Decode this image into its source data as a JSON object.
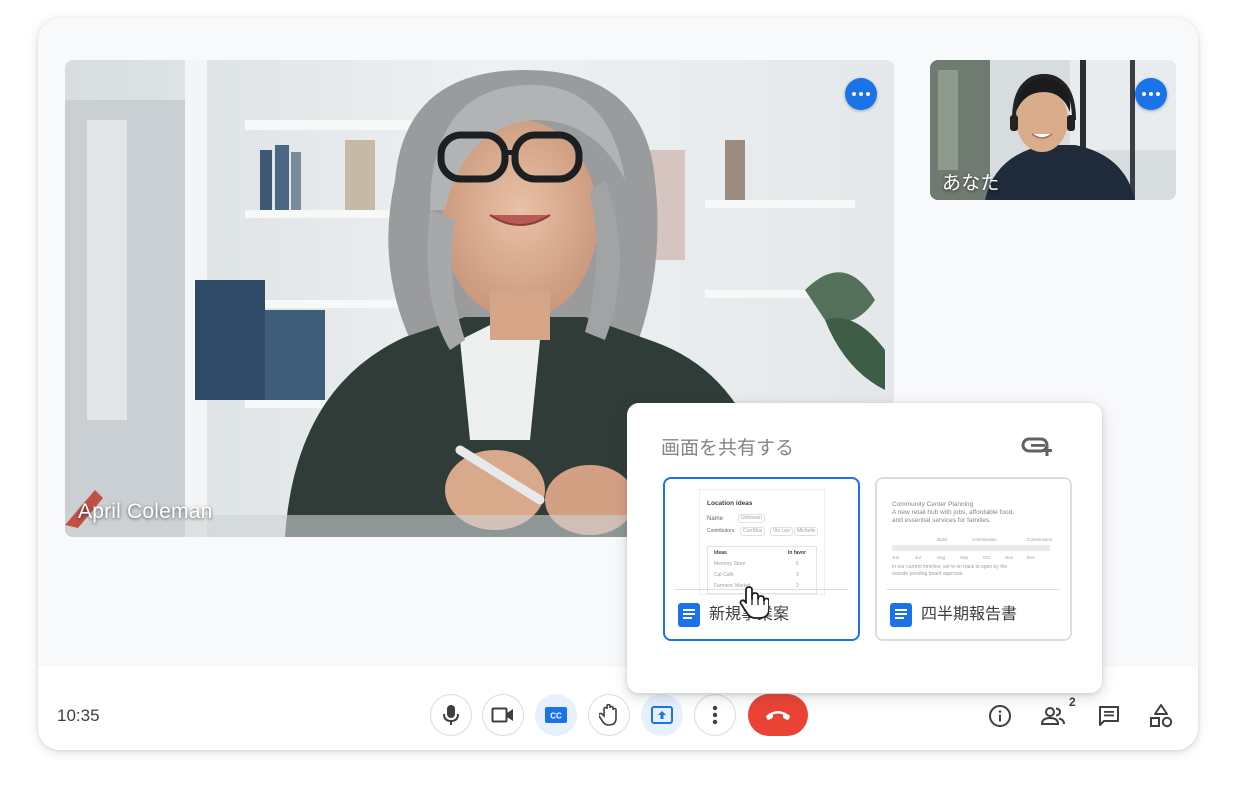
{
  "main_tile": {
    "participant_name": "April Coleman"
  },
  "self_tile": {
    "participant_name": "あなた"
  },
  "share_panel": {
    "title": "画面を共有する",
    "windows": [
      {
        "label": "新規事業案",
        "preview": {
          "heading": "Location ideas",
          "row_labels": [
            "Name",
            "Contributors"
          ],
          "name_value": "Unknown",
          "contributors": [
            "CurrMus",
            "Vin Lee",
            "Michelle"
          ],
          "table_headers": [
            "Ideas",
            "In favor"
          ],
          "table_rows": [
            [
              "Memory Store",
              "5"
            ],
            [
              "Cat Café",
              "3"
            ],
            [
              "Farmers' Market",
              "2"
            ]
          ]
        }
      },
      {
        "label": "四半期報告書",
        "preview": {
          "title": "Community Center Planning",
          "subtitle_lines": [
            "A new retail hub with jobs, affordable food,",
            "and essential services for families."
          ],
          "phases": [
            "Build",
            "Commission",
            "Construction"
          ],
          "months": [
            "Jun",
            "Jul",
            "Aug",
            "Sep",
            "Oct",
            "Nov",
            "Dec"
          ],
          "note_lines": [
            "In our current timeline, we're on track to open by the",
            "outside pending board approval."
          ]
        }
      }
    ]
  },
  "controls": {
    "time": "10:35",
    "participants_count": "2"
  },
  "colors": {
    "accent": "#1a73e8",
    "end_call": "#ea4335",
    "tint": "#e8f0fe"
  },
  "icons": [
    "mic-icon",
    "camera-icon",
    "captions-icon",
    "raise-hand-icon",
    "present-icon",
    "more-vert-icon",
    "end-call-icon",
    "info-icon",
    "people-icon",
    "chat-icon",
    "activities-icon",
    "add-window-icon",
    "document-icon",
    "hand-cursor-icon"
  ]
}
